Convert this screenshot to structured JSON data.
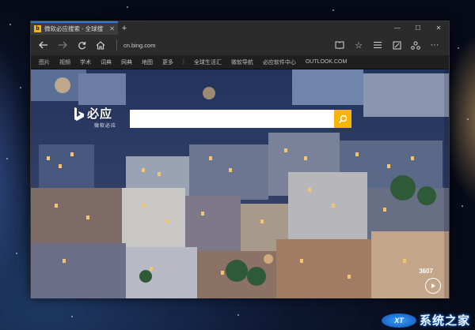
{
  "tab": {
    "title": "微软必应搜索 - 全球搜",
    "favicon": "bing-favicon"
  },
  "navbar": {
    "url": "cn.bing.com",
    "icons": [
      "back-icon",
      "forward-icon",
      "refresh-icon",
      "home-icon",
      "reading-view-icon",
      "favorite-star-icon",
      "hub-icon",
      "web-note-icon",
      "share-icon",
      "more-icon"
    ]
  },
  "links": [
    "图片",
    "视频",
    "学术",
    "词典",
    "网典",
    "地图",
    "更多",
    "全球生活汇",
    "微软导航",
    "必应软件中心",
    "OUTLOOK.COM"
  ],
  "bing": {
    "logo_text": "必应",
    "sub_text": "微软必应"
  },
  "search": {
    "value": "",
    "placeholder": ""
  },
  "page": {
    "counter": "3607"
  },
  "watermark": {
    "badge": "XT",
    "text": "系统之家"
  },
  "colors": {
    "accent": "#f7b500",
    "tab_highlight": "#2f7bd7"
  }
}
